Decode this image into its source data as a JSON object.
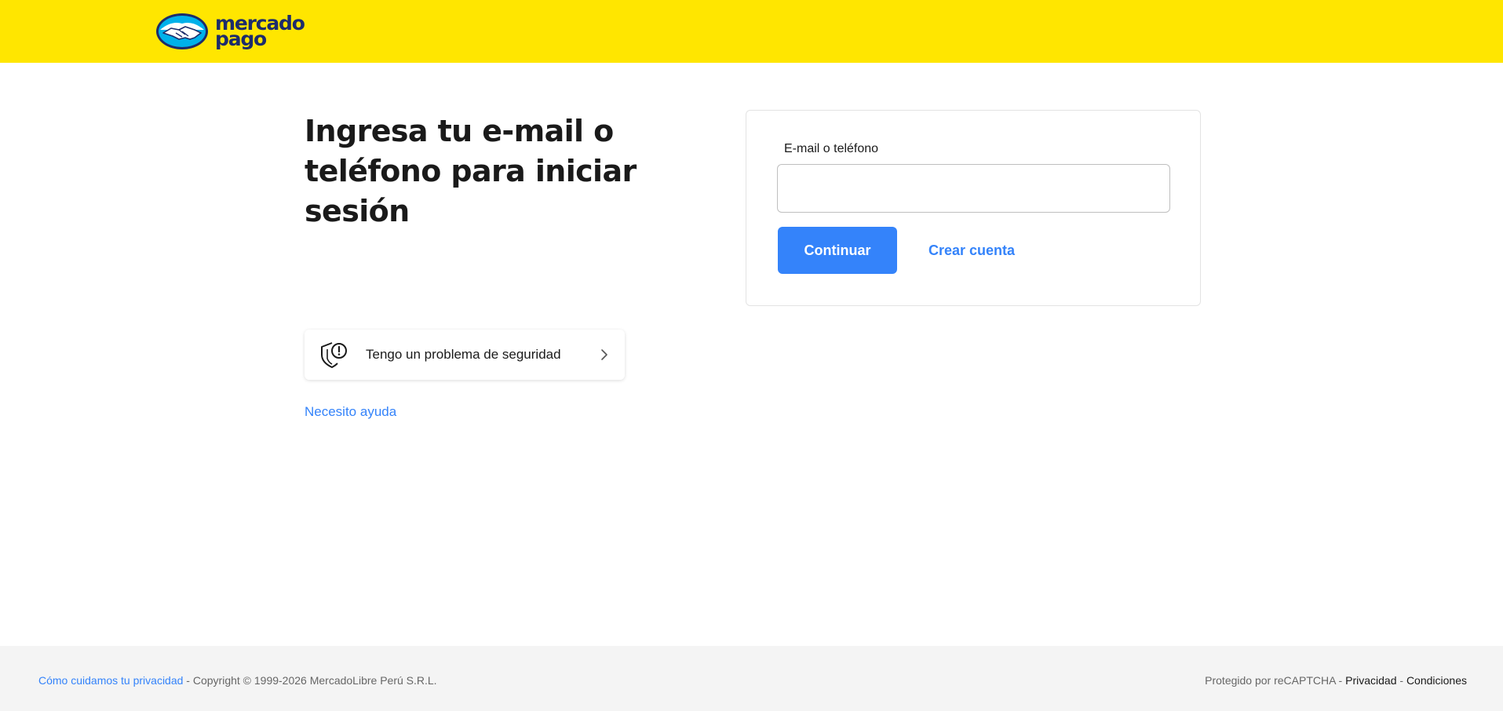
{
  "brand": {
    "logo_line1": "mercado",
    "logo_line2": "pago",
    "header_color": "#ffe600",
    "accent_color": "#3483fa"
  },
  "login": {
    "title": "Ingresa tu e-mail o teléfono para iniciar sesión",
    "field_label": "E-mail o teléfono",
    "field_value": "",
    "continue_label": "Continuar",
    "create_account_label": "Crear cuenta"
  },
  "security": {
    "icon": "shield-alert-icon",
    "label": "Tengo un problema de seguridad"
  },
  "help": {
    "label": "Necesito ayuda"
  },
  "footer": {
    "privacy_link": "Cómo cuidamos tu privacidad",
    "copyright": " - Copyright © 1999-2026 MercadoLibre Perú S.R.L.",
    "recaptcha_text": "Protegido por reCAPTCHA - ",
    "privacy_label": "Privacidad",
    "separator": " - ",
    "terms_label": "Condiciones"
  }
}
